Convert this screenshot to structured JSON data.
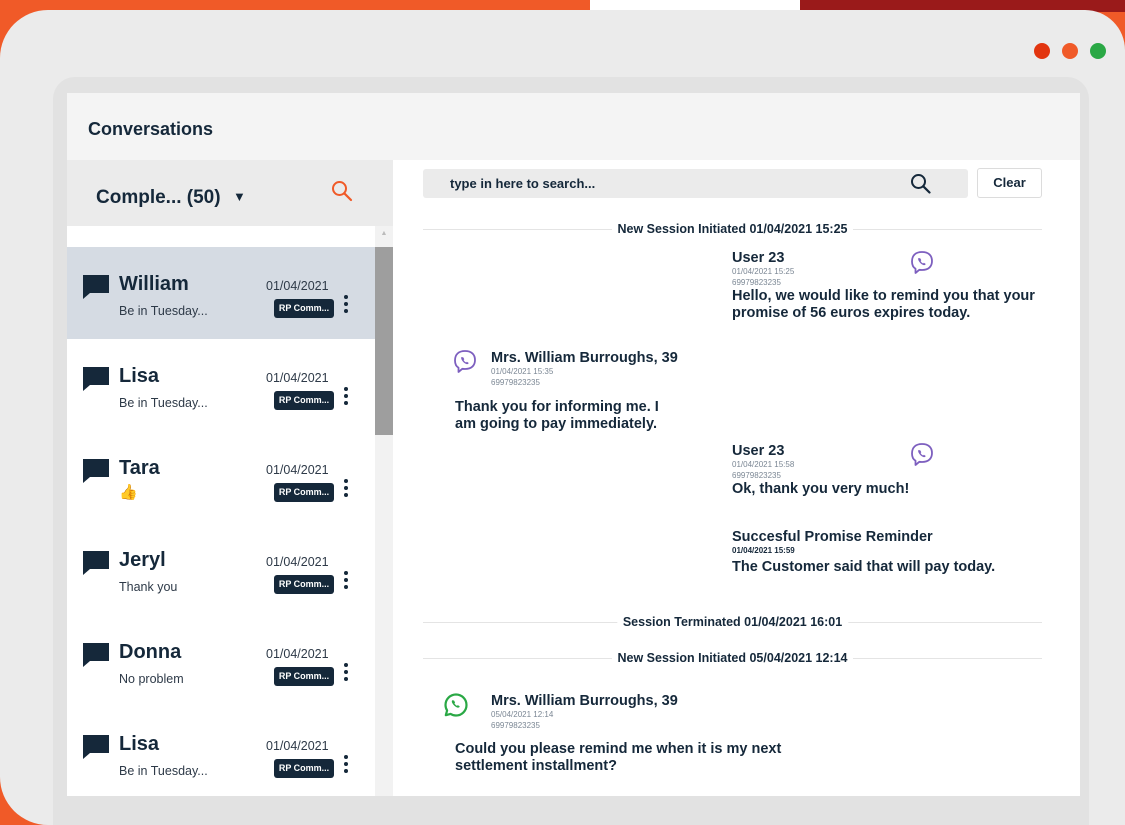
{
  "window": {
    "title": "Conversations",
    "dots": [
      "#e2350f",
      "#f05a28",
      "#2aa845"
    ]
  },
  "sidebar": {
    "filter": {
      "label": "Comple... (50)",
      "caret": "▼"
    },
    "items": [
      {
        "name": "William",
        "date": "01/04/2021",
        "preview": "Be in Tuesday...",
        "badge": "RP Comm...",
        "active": true
      },
      {
        "name": "Lisa",
        "date": "01/04/2021",
        "preview": "Be in Tuesday...",
        "badge": "RP Comm...",
        "active": false
      },
      {
        "name": "Tara",
        "date": "01/04/2021",
        "preview": "👍",
        "badge": "RP Comm...",
        "active": false
      },
      {
        "name": "Jeryl",
        "date": "01/04/2021",
        "preview": "Thank you",
        "badge": "RP Comm...",
        "active": false
      },
      {
        "name": "Donna",
        "date": "01/04/2021",
        "preview": "No problem",
        "badge": "RP Comm...",
        "active": false
      },
      {
        "name": "Lisa",
        "date": "01/04/2021",
        "preview": "Be in Tuesday...",
        "badge": "RP Comm...",
        "active": false
      }
    ]
  },
  "main": {
    "search": {
      "placeholder": "type in here to search...",
      "clear_label": "Clear"
    },
    "sessions": [
      "New Session Initiated 01/04/2021 15:25",
      "Session Terminated 01/04/2021 16:01",
      "New Session Initiated 05/04/2021 12:14"
    ],
    "messages": [
      {
        "sender": "User 23",
        "time": "01/04/2021 15:25",
        "phone": "69979823235",
        "text": "Hello, we would like to remind you that your promise of 56 euros expires today.",
        "channel": "viber",
        "side": "right"
      },
      {
        "sender": "Mrs. William Burroughs, 39",
        "time": "01/04/2021 15:35",
        "phone": "69979823235",
        "text": "Thank you for informing me. I am going to pay immediately.",
        "channel": "viber",
        "side": "left"
      },
      {
        "sender": "User 23",
        "time": "01/04/2021 15:58",
        "phone": "69979823235",
        "text": "Ok, thank you very much!",
        "channel": "viber",
        "side": "right"
      },
      {
        "sender": "Succesful Promise Reminder",
        "time": "01/04/2021 15:59",
        "phone": "",
        "text": "The Customer said that will pay today.",
        "channel": "",
        "side": "right"
      },
      {
        "sender": "Mrs. William Burroughs, 39",
        "time": "05/04/2021 12:14",
        "phone": "69979823235",
        "text": "Could you please remind me when it is my next settlement installment?",
        "channel": "whatsapp",
        "side": "left"
      }
    ]
  },
  "colors": {
    "accent": "#f05a28",
    "navy": "#15283a",
    "viber": "#7d5fbf",
    "whatsapp": "#2aa845"
  }
}
